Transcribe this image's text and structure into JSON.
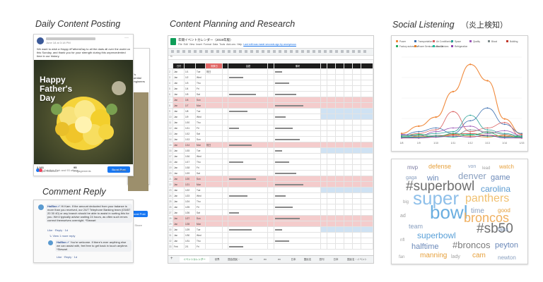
{
  "headings": {
    "daily": "Daily Content Posting",
    "planning": "Content Planning and Research",
    "social": "Social Listening",
    "social_jp": "（炎上検知）",
    "reply": "Comment Reply"
  },
  "post": {
    "date": "June 18 at 3:18 PM",
    "text": "We want to wish a Happy #FathersDay to all the dads all over the world on this Sunday, and thank you for your strength during this unprecedented time in our history.",
    "image_title_lines": [
      "Happy",
      "Father's",
      "Day"
    ],
    "stat1_value": "2,161",
    "stat1_label": "People Reached",
    "stat2_value": "95",
    "stat2_label": "Engagements",
    "boost_label": "Boost Post",
    "reactions": "Goldfish Fish and 93 others",
    "shares": "6 Shares",
    "back_shares": "2 Share",
    "back_text": "...it's essential ...engineers of"
  },
  "reply": {
    "comment1_author": "HalBan",
    "comment1_text": "Hi Kam. If the amount deducted from your balance is more than you received, our 24/7 Telephone Banking team (03457 20 30 40) or any branch should be able to assist in sorting this for you. We'd typically advise waiting 24 hours, as often such errors correct themselves overnight. *Stewart",
    "actions": "Like · Reply · 1d",
    "view_more": "View 1 more reply",
    "comment2_author": "HalBan",
    "comment2_text": "You're welcome. If there's ever anything else we can assist with, feel free to get back in touch anytime. *Stewart"
  },
  "sheet": {
    "title": "年間イベントカレンダー（2019年版）",
    "menu": [
      "File",
      "Edit",
      "View",
      "Insert",
      "Format",
      "Data",
      "Tools",
      "Add-ons",
      "Help"
    ],
    "last_edit": "Last edit was made seconds ago by anonymous",
    "header_cols": [
      "日付",
      "",
      "",
      "",
      "祝祭日",
      "",
      "話題",
      "",
      "備考"
    ],
    "rows": [
      [
        "Jan",
        "1/1",
        "Tue",
        "祝日"
      ],
      [
        "Jan",
        "1/2",
        "Wed",
        ""
      ],
      [
        "Jan",
        "1/3",
        "Thu",
        ""
      ],
      [
        "Jan",
        "1/4",
        "Fri",
        ""
      ],
      [
        "Jan",
        "1/5",
        "Sat",
        ""
      ],
      [
        "Jan",
        "1/6",
        "Sun",
        ""
      ],
      [
        "Jan",
        "1/7",
        "Mon",
        ""
      ],
      [
        "Jan",
        "1/8",
        "Tue",
        ""
      ],
      [
        "Jan",
        "1/9",
        "Wed",
        ""
      ],
      [
        "Jan",
        "1/10",
        "Thu",
        ""
      ],
      [
        "Jan",
        "1/11",
        "Fri",
        ""
      ],
      [
        "Jan",
        "1/12",
        "Sat",
        ""
      ],
      [
        "Jan",
        "1/13",
        "Sun",
        ""
      ],
      [
        "Jan",
        "1/14",
        "Mon",
        "祝日"
      ],
      [
        "Jan",
        "1/15",
        "Tue",
        ""
      ],
      [
        "Jan",
        "1/16",
        "Wed",
        ""
      ],
      [
        "Jan",
        "1/17",
        "Thu",
        ""
      ],
      [
        "Jan",
        "1/18",
        "Fri",
        ""
      ],
      [
        "Jan",
        "1/19",
        "Sat",
        ""
      ],
      [
        "Jan",
        "1/20",
        "Sun",
        ""
      ],
      [
        "Jan",
        "1/21",
        "Mon",
        ""
      ],
      [
        "Jan",
        "1/22",
        "Tue",
        ""
      ],
      [
        "Jan",
        "1/23",
        "Wed",
        ""
      ],
      [
        "Jan",
        "1/24",
        "Thu",
        ""
      ],
      [
        "Jan",
        "1/25",
        "Fri",
        ""
      ],
      [
        "Jan",
        "1/26",
        "Sat",
        ""
      ],
      [
        "Jan",
        "1/27",
        "Sun",
        ""
      ],
      [
        "Jan",
        "1/28",
        "Mon",
        ""
      ],
      [
        "Jan",
        "1/29",
        "Tue",
        ""
      ],
      [
        "Jan",
        "1/30",
        "Wed",
        ""
      ],
      [
        "Jan",
        "1/31",
        "Thu",
        ""
      ],
      [
        "Feb",
        "2/1",
        "Fri",
        ""
      ]
    ],
    "tabs": [
      "イベントカレンダー",
      "世界",
      "国会国民・",
      "ex",
      "ex",
      "ex",
      "日本",
      "国民名",
      "週刊",
      "日本",
      "国民名・イベント",
      "Config"
    ]
  },
  "chart_data": {
    "type": "line",
    "categories": [
      "1/8",
      "1/9",
      "1/10",
      "1/11",
      "1/12",
      "1/13",
      "1/14",
      "1/15"
    ],
    "legend": [
      "Power",
      "Transportation",
      "Air Conditioning",
      "Space",
      "Quality",
      "Blood",
      "Building",
      "Factory automation",
      "Power Semiconductor Devices",
      "Recruit",
      "Refrigeration"
    ],
    "colors": [
      "#f08a3c",
      "#3c6fb0",
      "#d95f5f",
      "#2aa198",
      "#9b59b6",
      "#7f8c8d",
      "#c0392b",
      "#27ae60",
      "#e67e22",
      "#1abc9c",
      "#8e44ad"
    ],
    "series": [
      {
        "name": "Power",
        "values": [
          6,
          14,
          24,
          52,
          82,
          64,
          22,
          5
        ]
      },
      {
        "name": "Transportation",
        "values": [
          4,
          8,
          12,
          6,
          20,
          34,
          16,
          6
        ]
      },
      {
        "name": "Air Conditioning",
        "values": [
          3,
          6,
          10,
          30,
          8,
          12,
          18,
          2
        ]
      },
      {
        "name": "Space",
        "values": [
          2,
          4,
          6,
          8,
          26,
          10,
          6,
          3
        ]
      },
      {
        "name": "Quality",
        "values": [
          5,
          3,
          8,
          12,
          14,
          6,
          9,
          4
        ]
      },
      {
        "name": "Blood",
        "values": [
          1,
          2,
          4,
          3,
          10,
          8,
          5,
          2
        ]
      },
      {
        "name": "Building",
        "values": [
          2,
          1,
          3,
          5,
          6,
          4,
          3,
          1
        ]
      },
      {
        "name": "Factory automation",
        "values": [
          3,
          5,
          2,
          6,
          4,
          7,
          2,
          3
        ]
      },
      {
        "name": "Power Semiconductor Devices",
        "values": [
          1,
          3,
          2,
          4,
          3,
          2,
          4,
          1
        ]
      },
      {
        "name": "Recruit",
        "values": [
          2,
          2,
          3,
          2,
          5,
          3,
          2,
          2
        ]
      },
      {
        "name": "Refrigeration",
        "values": [
          1,
          1,
          2,
          3,
          2,
          4,
          1,
          1
        ]
      }
    ],
    "ylim": [
      0,
      90
    ]
  },
  "wordcloud": [
    {
      "text": "mvp",
      "color": "#7a7aa0",
      "size": 8
    },
    {
      "text": "defense",
      "color": "#e6a03c",
      "size": 9
    },
    {
      "text": "von",
      "color": "#8aa0c0",
      "size": 7
    },
    {
      "text": "lead",
      "color": "#a0a0a0",
      "size": 6
    },
    {
      "text": "watch",
      "color": "#e6a03c",
      "size": 8
    },
    {
      "text": "gaga",
      "color": "#8aa0c0",
      "size": 7
    },
    {
      "text": "win",
      "color": "#6a88b8",
      "size": 11
    },
    {
      "text": "denver",
      "color": "#8aa0c0",
      "size": 13
    },
    {
      "text": "game",
      "color": "#6a88b8",
      "size": 11
    },
    {
      "text": "#superbowl",
      "color": "#6e6e6e",
      "size": 19
    },
    {
      "text": "carolina",
      "color": "#5a9ad0",
      "size": 12
    },
    {
      "text": "big",
      "color": "#a0a0a0",
      "size": 6
    },
    {
      "text": "super",
      "color": "#8fc0ea",
      "size": 26
    },
    {
      "text": "panthers",
      "color": "#f0c070",
      "size": 16
    },
    {
      "text": "time",
      "color": "#8aa0c0",
      "size": 10
    },
    {
      "text": "good",
      "color": "#e6a03c",
      "size": 8
    },
    {
      "text": "ad",
      "color": "#a0a0a0",
      "size": 7
    },
    {
      "text": "bowl",
      "color": "#6aaee0",
      "size": 26
    },
    {
      "text": "broncos",
      "color": "#f0b060",
      "size": 18
    },
    {
      "text": "team",
      "color": "#8aa0c0",
      "size": 9
    },
    {
      "text": "#sb50",
      "color": "#707070",
      "size": 19
    },
    {
      "text": "fans",
      "color": "#8aa0c0",
      "size": 8
    },
    {
      "text": "superbowl",
      "color": "#5aa0d8",
      "size": 12
    },
    {
      "text": "halftime",
      "color": "#6a88b8",
      "size": 11
    },
    {
      "text": "#broncos",
      "color": "#7a7a7a",
      "size": 13
    },
    {
      "text": "peyton",
      "color": "#6a88b8",
      "size": 11
    },
    {
      "text": "manning",
      "color": "#e6a03c",
      "size": 10
    },
    {
      "text": "lady",
      "color": "#a0a0a0",
      "size": 7
    },
    {
      "text": "cam",
      "color": "#e6a03c",
      "size": 10
    },
    {
      "text": "newton",
      "color": "#8aa0c0",
      "size": 8
    },
    {
      "text": "fan",
      "color": "#a0a0a0",
      "size": 6
    },
    {
      "text": "nfl",
      "color": "#a0a0a0",
      "size": 6
    }
  ]
}
